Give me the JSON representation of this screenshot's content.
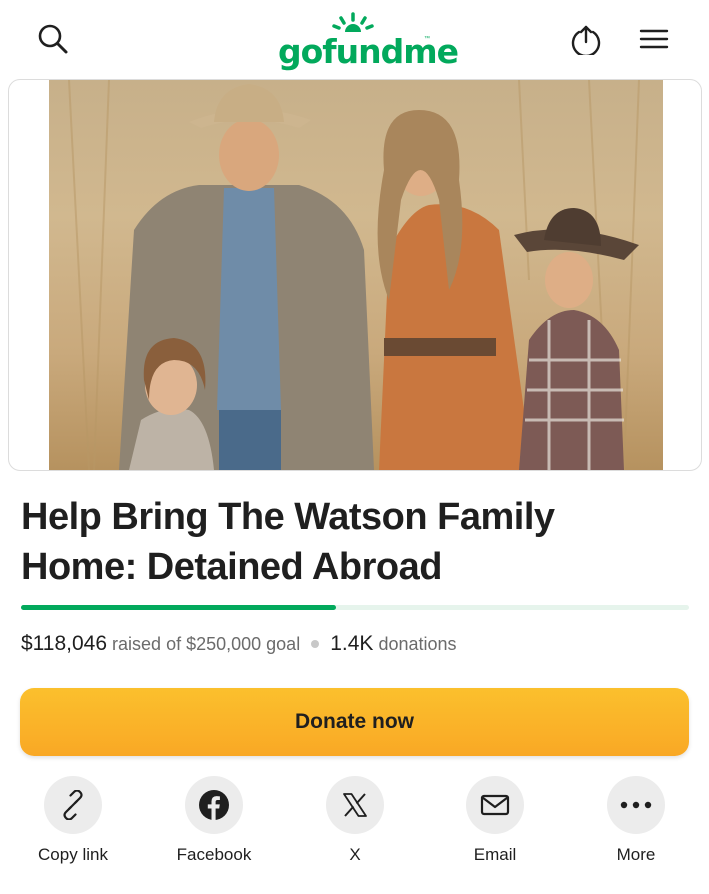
{
  "header": {
    "logo_text": "gofundme",
    "logo_tm": "™",
    "icons": [
      "search-icon",
      "share-upload-icon",
      "hamburger-menu-icon"
    ]
  },
  "campaign": {
    "title": "Help Bring The Watson Family Home: Detained Abroad",
    "raised": "$118,046",
    "raised_suffix": "raised of $250,000 goal",
    "donations_count": "1.4K",
    "donations_label": "donations",
    "progress_fraction": 0.472
  },
  "donate_button": {
    "label": "Donate now"
  },
  "share": [
    {
      "label": "Copy link",
      "icon": "link-icon"
    },
    {
      "label": "Facebook",
      "icon": "facebook-icon"
    },
    {
      "label": "X",
      "icon": "x-logo-icon"
    },
    {
      "label": "Email",
      "icon": "email-icon"
    },
    {
      "label": "More",
      "icon": "more-dots-icon"
    }
  ],
  "colors": {
    "brand_green": "#02a95c",
    "donate_yellow": "#f9a825",
    "progress_track": "#e6f4ec",
    "share_circle": "#ececec"
  }
}
